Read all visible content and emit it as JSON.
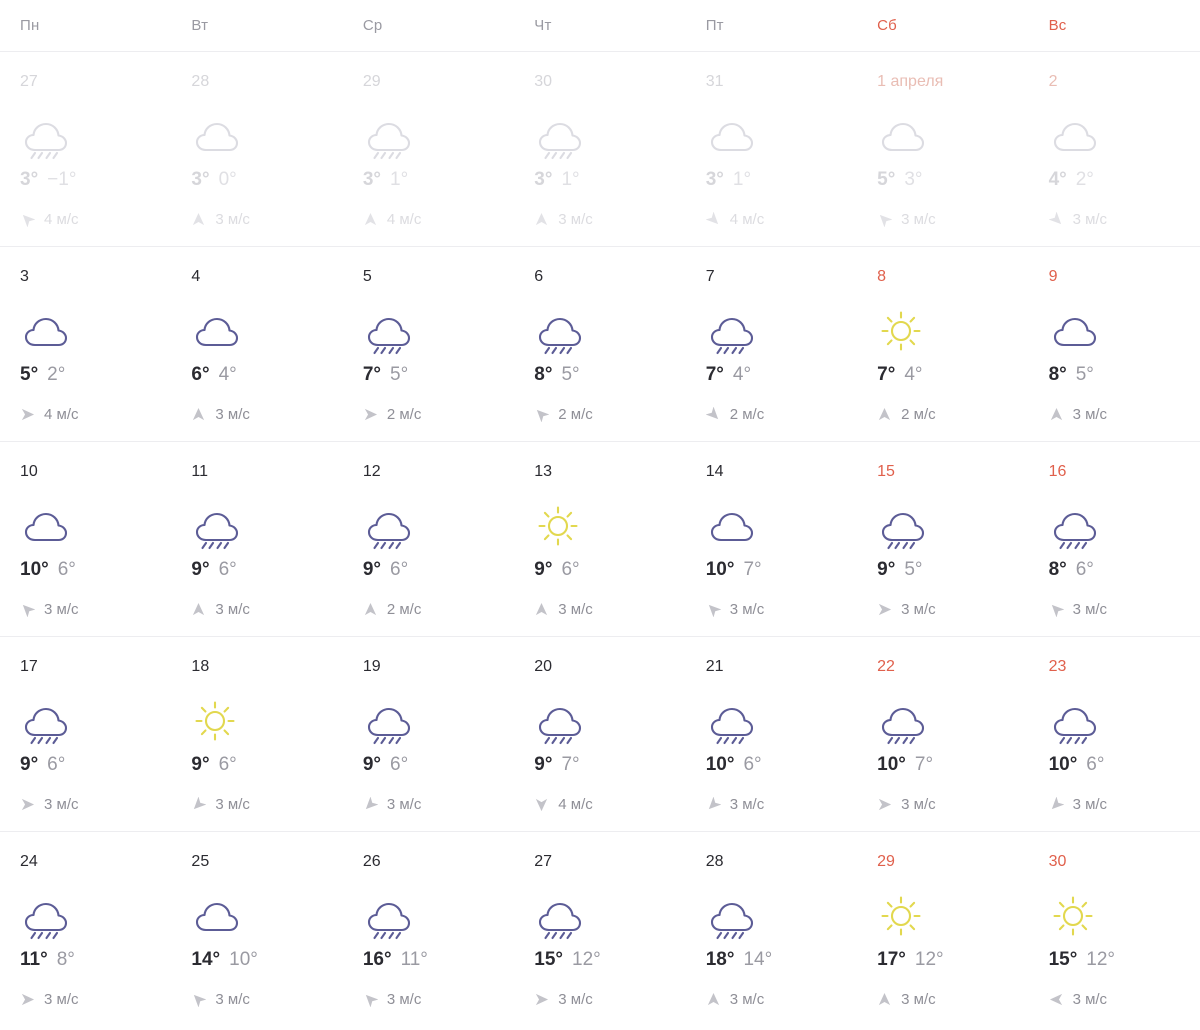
{
  "weekdays": [
    {
      "label": "Пн",
      "weekend": false
    },
    {
      "label": "Вт",
      "weekend": false
    },
    {
      "label": "Ср",
      "weekend": false
    },
    {
      "label": "Чт",
      "weekend": false
    },
    {
      "label": "Пт",
      "weekend": false
    },
    {
      "label": "Сб",
      "weekend": true
    },
    {
      "label": "Вс",
      "weekend": true
    }
  ],
  "colors": {
    "weekend": "#e0604c",
    "cloud": "#5c5c96",
    "sun": "#e2d84e",
    "temp_high": "#2b2b31",
    "temp_low": "#9a9aa2",
    "wind": "#8f8f97",
    "muted": "#d6d6da",
    "divider": "#ededf0"
  },
  "wind_unit": "м/с",
  "weeks": [
    {
      "faded": true,
      "days": [
        {
          "day": "27",
          "weekend": false,
          "icon": "rain-icon",
          "hi": "3°",
          "lo": "−1°",
          "wind": "4",
          "wind_dir": 315
        },
        {
          "day": "28",
          "weekend": false,
          "icon": "cloud-icon",
          "hi": "3°",
          "lo": "0°",
          "wind": "3",
          "wind_dir": 0
        },
        {
          "day": "29",
          "weekend": false,
          "icon": "rain-icon",
          "hi": "3°",
          "lo": "1°",
          "wind": "4",
          "wind_dir": 0
        },
        {
          "day": "30",
          "weekend": false,
          "icon": "rain-icon",
          "hi": "3°",
          "lo": "1°",
          "wind": "3",
          "wind_dir": 0
        },
        {
          "day": "31",
          "weekend": false,
          "icon": "cloud-icon",
          "hi": "3°",
          "lo": "1°",
          "wind": "4",
          "wind_dir": 135
        },
        {
          "day": "1 апреля",
          "weekend": true,
          "icon": "cloud-icon",
          "hi": "5°",
          "lo": "3°",
          "wind": "3",
          "wind_dir": 315
        },
        {
          "day": "2",
          "weekend": true,
          "icon": "cloud-icon",
          "hi": "4°",
          "lo": "2°",
          "wind": "3",
          "wind_dir": 135
        }
      ]
    },
    {
      "faded": false,
      "days": [
        {
          "day": "3",
          "weekend": false,
          "icon": "cloud-icon",
          "hi": "5°",
          "lo": "2°",
          "wind": "4",
          "wind_dir": 90
        },
        {
          "day": "4",
          "weekend": false,
          "icon": "cloud-icon",
          "hi": "6°",
          "lo": "4°",
          "wind": "3",
          "wind_dir": 0
        },
        {
          "day": "5",
          "weekend": false,
          "icon": "rain-icon",
          "hi": "7°",
          "lo": "5°",
          "wind": "2",
          "wind_dir": 90
        },
        {
          "day": "6",
          "weekend": false,
          "icon": "rain-icon",
          "hi": "8°",
          "lo": "5°",
          "wind": "2",
          "wind_dir": 315
        },
        {
          "day": "7",
          "weekend": false,
          "icon": "rain-icon",
          "hi": "7°",
          "lo": "4°",
          "wind": "2",
          "wind_dir": 135
        },
        {
          "day": "8",
          "weekend": true,
          "icon": "sun-icon",
          "hi": "7°",
          "lo": "4°",
          "wind": "2",
          "wind_dir": 0
        },
        {
          "day": "9",
          "weekend": true,
          "icon": "cloud-icon",
          "hi": "8°",
          "lo": "5°",
          "wind": "3",
          "wind_dir": 0
        }
      ]
    },
    {
      "faded": false,
      "days": [
        {
          "day": "10",
          "weekend": false,
          "icon": "cloud-icon",
          "hi": "10°",
          "lo": "6°",
          "wind": "3",
          "wind_dir": 315
        },
        {
          "day": "11",
          "weekend": false,
          "icon": "rain-icon",
          "hi": "9°",
          "lo": "6°",
          "wind": "3",
          "wind_dir": 0
        },
        {
          "day": "12",
          "weekend": false,
          "icon": "rain-icon",
          "hi": "9°",
          "lo": "6°",
          "wind": "2",
          "wind_dir": 0
        },
        {
          "day": "13",
          "weekend": false,
          "icon": "sun-icon",
          "hi": "9°",
          "lo": "6°",
          "wind": "3",
          "wind_dir": 0
        },
        {
          "day": "14",
          "weekend": false,
          "icon": "cloud-icon",
          "hi": "10°",
          "lo": "7°",
          "wind": "3",
          "wind_dir": 315
        },
        {
          "day": "15",
          "weekend": true,
          "icon": "rain-icon",
          "hi": "9°",
          "lo": "5°",
          "wind": "3",
          "wind_dir": 90
        },
        {
          "day": "16",
          "weekend": true,
          "icon": "rain-icon",
          "hi": "8°",
          "lo": "6°",
          "wind": "3",
          "wind_dir": 315
        }
      ]
    },
    {
      "faded": false,
      "days": [
        {
          "day": "17",
          "weekend": false,
          "icon": "rain-icon",
          "hi": "9°",
          "lo": "6°",
          "wind": "3",
          "wind_dir": 90
        },
        {
          "day": "18",
          "weekend": false,
          "icon": "sun-icon",
          "hi": "9°",
          "lo": "6°",
          "wind": "3",
          "wind_dir": 225
        },
        {
          "day": "19",
          "weekend": false,
          "icon": "rain-icon",
          "hi": "9°",
          "lo": "6°",
          "wind": "3",
          "wind_dir": 225
        },
        {
          "day": "20",
          "weekend": false,
          "icon": "rain-icon",
          "hi": "9°",
          "lo": "7°",
          "wind": "4",
          "wind_dir": 180
        },
        {
          "day": "21",
          "weekend": false,
          "icon": "rain-icon",
          "hi": "10°",
          "lo": "6°",
          "wind": "3",
          "wind_dir": 225
        },
        {
          "day": "22",
          "weekend": true,
          "icon": "rain-icon",
          "hi": "10°",
          "lo": "7°",
          "wind": "3",
          "wind_dir": 90
        },
        {
          "day": "23",
          "weekend": true,
          "icon": "rain-icon",
          "hi": "10°",
          "lo": "6°",
          "wind": "3",
          "wind_dir": 225
        }
      ]
    },
    {
      "faded": false,
      "days": [
        {
          "day": "24",
          "weekend": false,
          "icon": "rain-icon",
          "hi": "11°",
          "lo": "8°",
          "wind": "3",
          "wind_dir": 90
        },
        {
          "day": "25",
          "weekend": false,
          "icon": "cloud-icon",
          "hi": "14°",
          "lo": "10°",
          "wind": "3",
          "wind_dir": 315
        },
        {
          "day": "26",
          "weekend": false,
          "icon": "rain-icon",
          "hi": "16°",
          "lo": "11°",
          "wind": "3",
          "wind_dir": 315
        },
        {
          "day": "27",
          "weekend": false,
          "icon": "rain-icon",
          "hi": "15°",
          "lo": "12°",
          "wind": "3",
          "wind_dir": 90
        },
        {
          "day": "28",
          "weekend": false,
          "icon": "rain-icon",
          "hi": "18°",
          "lo": "14°",
          "wind": "3",
          "wind_dir": 0
        },
        {
          "day": "29",
          "weekend": true,
          "icon": "sun-icon",
          "hi": "17°",
          "lo": "12°",
          "wind": "3",
          "wind_dir": 0
        },
        {
          "day": "30",
          "weekend": true,
          "icon": "sun-icon",
          "hi": "15°",
          "lo": "12°",
          "wind": "3",
          "wind_dir": 270
        }
      ]
    }
  ]
}
